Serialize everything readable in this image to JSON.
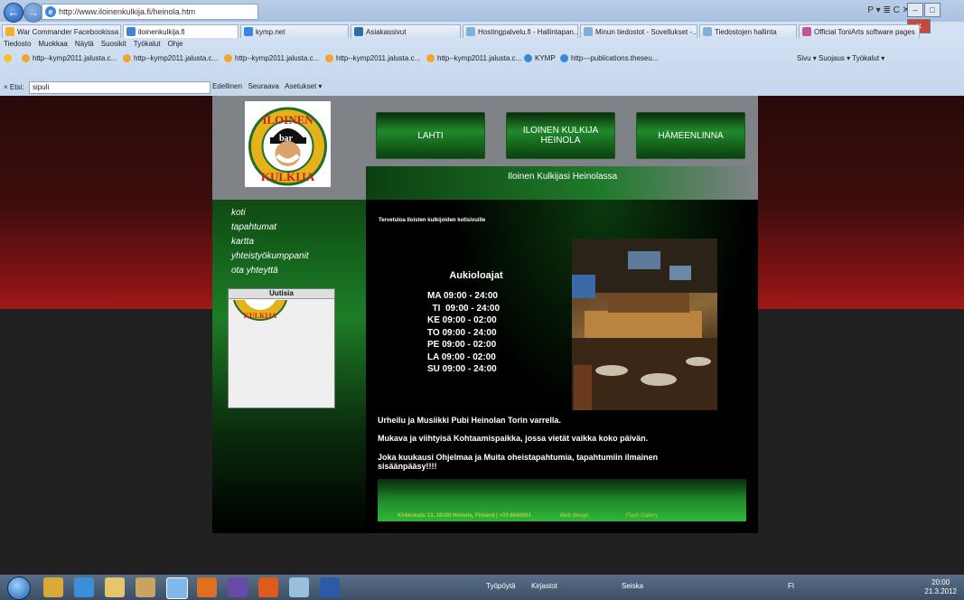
{
  "browser": {
    "url": "http://www.iloinenkulkija.fi/heinola.htm",
    "right_tools": "Ρ ▾ ≣ C ✕",
    "tabs": [
      {
        "label": "War Commander Facebookissa"
      },
      {
        "label": "iloinenkulkija.fi"
      },
      {
        "label": "kymp.net"
      },
      {
        "label": "Asiakassivut"
      },
      {
        "label": "Hostingpalvelu.fi - Hallintapan..."
      },
      {
        "label": "Minun tiedostot - Sovellukset -..."
      },
      {
        "label": "Tiedostojen hallinta"
      },
      {
        "label": "Official ToniArts software pages"
      }
    ],
    "menu": [
      "Tiedosto",
      "Muokkaa",
      "Näytä",
      "Suosikit",
      "Työkalut",
      "Ohje"
    ],
    "favorites": [
      "http--kymp2011.jalusta.c...",
      "http--kymp2011.jalusta.c...",
      "http--kymp2011.jalusta.c...",
      "http--kymp2011.jalusta.c...",
      "http--kymp2011.jalusta.c...",
      "KYMP",
      "http---publications.theseu..."
    ],
    "fav_tools": "Sivu ▾   Suojaus ▾   Työkalut ▾",
    "find_label": "× Etsi:",
    "find_value": "sipuli",
    "find_prev": "Edellinen",
    "find_next": "Seuraava",
    "find_options": "Asetukset ▾"
  },
  "site": {
    "logo_text": "bar",
    "nav": [
      "LAHTI",
      "ILOINEN KULKIJA HEINOLA",
      "HÄMEENLINNA"
    ],
    "subtitle": "Iloinen Kulkijasi Heinolassa",
    "sidebar": [
      "koti",
      "tapahtumat",
      "kartta",
      "yhteistyökumppanit",
      "ota yhteyttä"
    ],
    "news_title": "Uutisia",
    "welcome": "Tervetuloa Iloisten kulkijoiden kotisivuille",
    "hours_title": "Aukioloajat",
    "hours": [
      "MA 09:00 - 24:00",
      "  TI  09:00 - 24:00",
      "KE 09:00 - 02:00",
      "TO 09:00 - 24:00",
      "PE 09:00 - 02:00",
      "LA 09:00 - 02:00",
      "SU 09:00 - 24:00"
    ],
    "texts": [
      "Urheilu ja Musiikki Pubi Heinolan Torin varrella.",
      "Mukava ja viihtyisä Kohtaamispaikka, jossa vietät vaikka koko päivän.",
      "Joka kuukausi Ohjelmaa ja Muita oheistapahtumia, tapahtumiin ilmainen sisäänpääsy!!!!"
    ],
    "footer_address": "Kirkkokatu 13, 18100 Heinola, Finland | +03-8840061",
    "footer_webdesign": "Web design",
    "footer_gallery": "Flash Gallery"
  },
  "taskbar": {
    "items": [
      "Työpöytä",
      "Kirjastot",
      "Seiska"
    ],
    "time": "20:00",
    "date": "21.3.2012",
    "lang": "FI"
  }
}
